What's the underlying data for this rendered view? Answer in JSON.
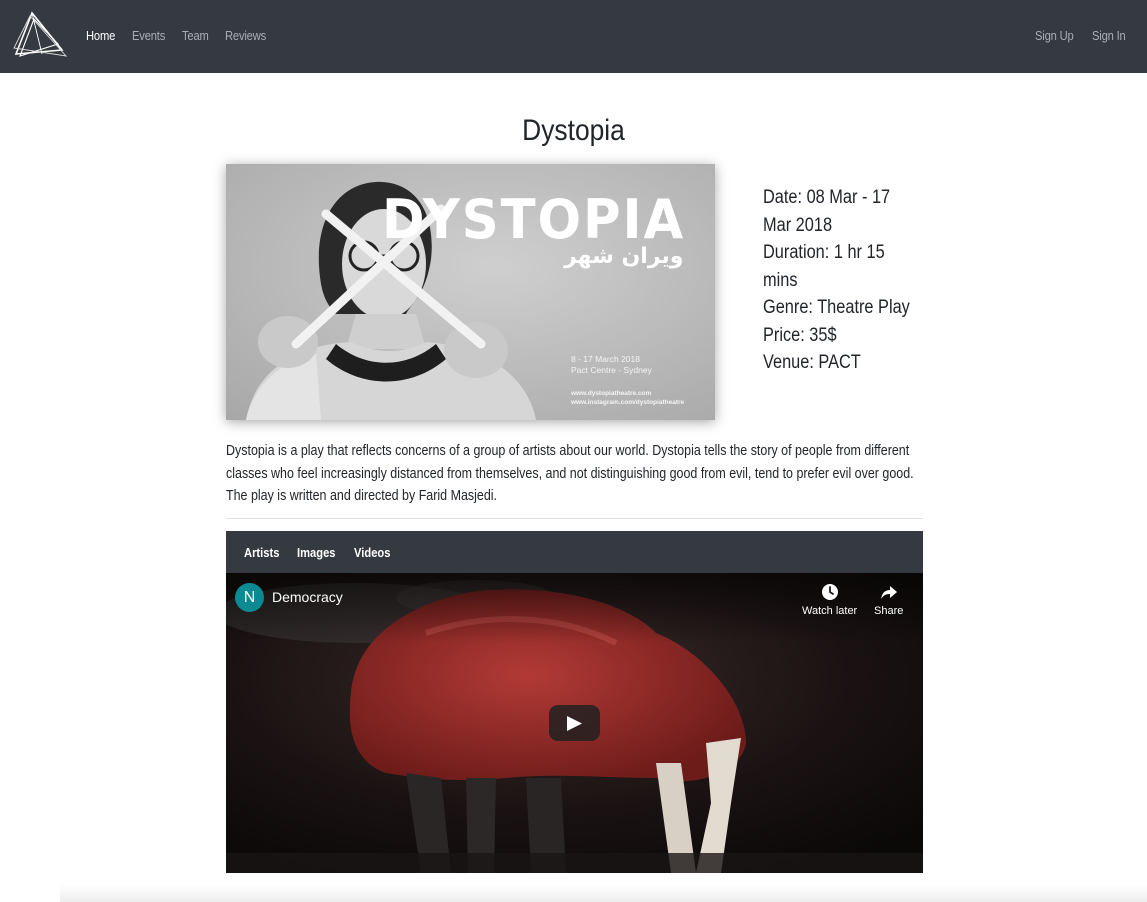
{
  "nav": {
    "logo": "triangle-logo",
    "items": [
      {
        "label": "Home",
        "active": true
      },
      {
        "label": "Events",
        "active": false
      },
      {
        "label": "Team",
        "active": false
      },
      {
        "label": "Reviews",
        "active": false
      }
    ],
    "auth": [
      {
        "label": "Sign Up"
      },
      {
        "label": "Sign In"
      }
    ]
  },
  "event": {
    "title": "Dystopia",
    "poster": {
      "word": "DYSTOPIA",
      "arabic": "ویران شهر",
      "dates_line1": "8 - 17 March 2018",
      "dates_line2": "Pact Centre - Sydney",
      "link1": "www.dystopiatheatre.com",
      "link2": "www.instagram.com/dystopiatheatre"
    },
    "details": {
      "date_line1": "Date: 08 Mar - 17",
      "date_line2": "Mar 2018",
      "duration_line1": "Duration: 1 hr 15",
      "duration_line2": "mins",
      "genre": "Genre: Theatre Play",
      "price": "Price: 35$",
      "venue": "Venue: PACT"
    },
    "description": "Dystopia is a play that reflects concerns of a group of artists about our world. Dystopia tells the story of people from different classes who feel increasingly distanced from themselves, and not distinguishing good from evil, tend to prefer evil over good. The play is written and directed by Farid Masjedi."
  },
  "media": {
    "tabs": [
      {
        "label": "Artists"
      },
      {
        "label": "Images"
      },
      {
        "label": "Videos"
      }
    ],
    "video": {
      "channel_initial": "N",
      "title": "Democracy",
      "watch_later": "Watch later",
      "share": "Share",
      "icons": {
        "watch_later": "clock-icon",
        "share": "share-arrow-icon",
        "play": "play-icon"
      }
    }
  },
  "colors": {
    "navbar": "#343a40",
    "nav_inactive": "#a9aeb3",
    "channel_avatar": "#0c8a93"
  }
}
